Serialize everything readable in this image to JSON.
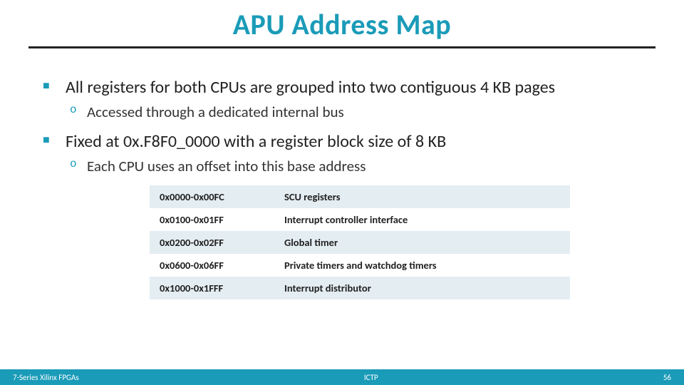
{
  "title": "APU Address Map",
  "bullets": [
    {
      "text": "All registers for both CPUs are grouped into two contiguous 4 KB pages",
      "sub": [
        "Accessed through a dedicated internal bus"
      ]
    },
    {
      "text": "Fixed at 0x.F8F0_0000 with a register block size of 8 KB",
      "sub": [
        "Each CPU uses an offset into this base address"
      ]
    }
  ],
  "table": [
    {
      "range": "0x0000-0x00FC",
      "desc": "SCU registers"
    },
    {
      "range": "0x0100-0x01FF",
      "desc": "Interrupt controller interface"
    },
    {
      "range": "0x0200-0x02FF",
      "desc": "Global timer"
    },
    {
      "range": "0x0600-0x06FF",
      "desc": "Private timers and watchdog timers"
    },
    {
      "range": "0x1000-0x1FFF",
      "desc": "Interrupt distributor"
    }
  ],
  "footer": {
    "left": "7-Series Xilinx FPGAs",
    "center": "ICTP",
    "right": "56"
  },
  "colors": {
    "accent": "#1a9bb8"
  }
}
